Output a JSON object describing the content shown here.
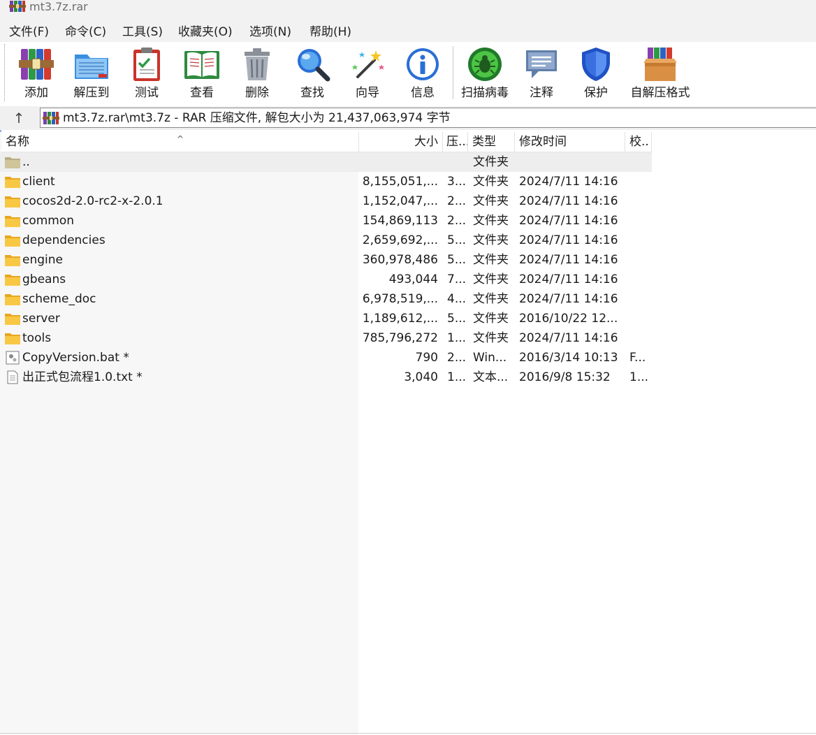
{
  "window": {
    "title": "mt3.7z.rar"
  },
  "menu": [
    "文件(F)",
    "命令(C)",
    "工具(S)",
    "收藏夹(O)",
    "选项(N)",
    "帮助(H)"
  ],
  "toolbar": {
    "buttons": [
      {
        "label": "添加",
        "icon": "archive-books-icon"
      },
      {
        "label": "解压到",
        "icon": "folder-extract-icon"
      },
      {
        "label": "测试",
        "icon": "clipboard-check-icon"
      },
      {
        "label": "查看",
        "icon": "open-book-icon"
      },
      {
        "label": "删除",
        "icon": "trash-can-icon"
      },
      {
        "label": "查找",
        "icon": "magnifier-icon"
      },
      {
        "label": "向导",
        "icon": "magic-wand-icon"
      },
      {
        "label": "信息",
        "icon": "info-icon"
      },
      {
        "label": "扫描病毒",
        "icon": "virus-scan-icon"
      },
      {
        "label": "注释",
        "icon": "comment-bubble-icon"
      },
      {
        "label": "保护",
        "icon": "shield-icon"
      },
      {
        "label": "自解压格式",
        "icon": "sfx-box-icon"
      }
    ]
  },
  "address": {
    "up_symbol": "↑",
    "path": "mt3.7z.rar\\mt3.7z - RAR 压缩文件, 解包大小为 21,437,063,974 字节"
  },
  "columns": {
    "name": "名称",
    "size": "大小",
    "packed": "压...",
    "type": "类型",
    "modified": "修改时间",
    "crc": "校.."
  },
  "files": [
    {
      "name": "..",
      "size": "",
      "packed": "",
      "type": "文件夹",
      "modified": "",
      "crc": "",
      "icon": "folder-up"
    },
    {
      "name": "client",
      "size": "8,155,051,...",
      "packed": "3...",
      "type": "文件夹",
      "modified": "2024/7/11 14:16",
      "crc": "",
      "icon": "folder"
    },
    {
      "name": "cocos2d-2.0-rc2-x-2.0.1",
      "size": "1,152,047,...",
      "packed": "2...",
      "type": "文件夹",
      "modified": "2024/7/11 14:16",
      "crc": "",
      "icon": "folder"
    },
    {
      "name": "common",
      "size": "154,869,113",
      "packed": "2...",
      "type": "文件夹",
      "modified": "2024/7/11 14:16",
      "crc": "",
      "icon": "folder"
    },
    {
      "name": "dependencies",
      "size": "2,659,692,...",
      "packed": "5...",
      "type": "文件夹",
      "modified": "2024/7/11 14:16",
      "crc": "",
      "icon": "folder"
    },
    {
      "name": "engine",
      "size": "360,978,486",
      "packed": "5...",
      "type": "文件夹",
      "modified": "2024/7/11 14:16",
      "crc": "",
      "icon": "folder"
    },
    {
      "name": "gbeans",
      "size": "493,044",
      "packed": "7...",
      "type": "文件夹",
      "modified": "2024/7/11 14:16",
      "crc": "",
      "icon": "folder"
    },
    {
      "name": "scheme_doc",
      "size": "6,978,519,...",
      "packed": "4...",
      "type": "文件夹",
      "modified": "2024/7/11 14:16",
      "crc": "",
      "icon": "folder"
    },
    {
      "name": "server",
      "size": "1,189,612,...",
      "packed": "5...",
      "type": "文件夹",
      "modified": "2016/10/22 12...",
      "crc": "",
      "icon": "folder"
    },
    {
      "name": "tools",
      "size": "785,796,272",
      "packed": "1...",
      "type": "文件夹",
      "modified": "2024/7/11 14:16",
      "crc": "",
      "icon": "folder"
    },
    {
      "name": "CopyVersion.bat *",
      "size": "790",
      "packed": "2...",
      "type": "Win...",
      "modified": "2016/3/14 10:13",
      "crc": "F...",
      "icon": "batch-file"
    },
    {
      "name": "出正式包流程1.0.txt *",
      "size": "3,040",
      "packed": "1...",
      "type": "文本...",
      "modified": "2016/9/8 15:32",
      "crc": "1...",
      "icon": "text-file"
    }
  ]
}
